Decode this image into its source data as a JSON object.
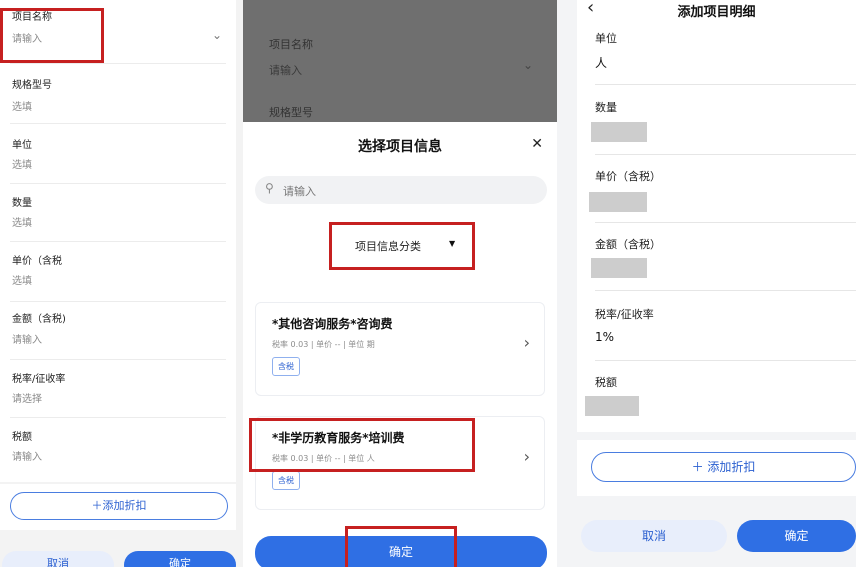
{
  "panel1": {
    "fields": [
      {
        "label": "项目名称",
        "value": "请输入"
      },
      {
        "label": "规格型号",
        "value": "选填"
      },
      {
        "label": "单位",
        "value": "选填"
      },
      {
        "label": "数量",
        "value": "选填"
      },
      {
        "label": "单价（含税",
        "value": "选填"
      },
      {
        "label": "金额（含税)",
        "value": "请输入"
      },
      {
        "label": "税率/征收率",
        "value": "请选择"
      },
      {
        "label": "税额",
        "value": "请输入"
      }
    ],
    "add_discount": "＋添加折扣",
    "cancel": "取消",
    "confirm": "确定"
  },
  "panel2": {
    "bg_fields": [
      {
        "label": "项目名称",
        "value": "请输入"
      },
      {
        "label": "规格型号",
        "value": ""
      }
    ],
    "title": "选择项目信息",
    "close": "✕",
    "search_placeholder": "请输入",
    "category": "项目信息分类",
    "category_arrow": "▼",
    "items": [
      {
        "title": "*其他咨询服务*咨询费",
        "meta": "税率 0.03 | 单价 -- | 单位 期",
        "tag": "含税"
      },
      {
        "title": "*非学历教育服务*培训费",
        "meta": "税率 0.03 | 单价 -- | 单位 人",
        "tag": "含税"
      }
    ],
    "confirm": "确定"
  },
  "panel3": {
    "back": "‹",
    "title": "添加项目明细",
    "fields": [
      {
        "label": "单位",
        "value": "人"
      },
      {
        "label": "数量",
        "value": ""
      },
      {
        "label": "单价（含税）",
        "value": ""
      },
      {
        "label": "金额（含税）",
        "value": ""
      },
      {
        "label": "税率/征收率",
        "value": "1%"
      },
      {
        "label": "税额",
        "value": ""
      }
    ],
    "add_discount": "＋ 添加折扣",
    "cancel": "取消",
    "confirm": "确定"
  },
  "colors": {
    "accent": "#2f6fe4",
    "highlight": "#c62020"
  }
}
